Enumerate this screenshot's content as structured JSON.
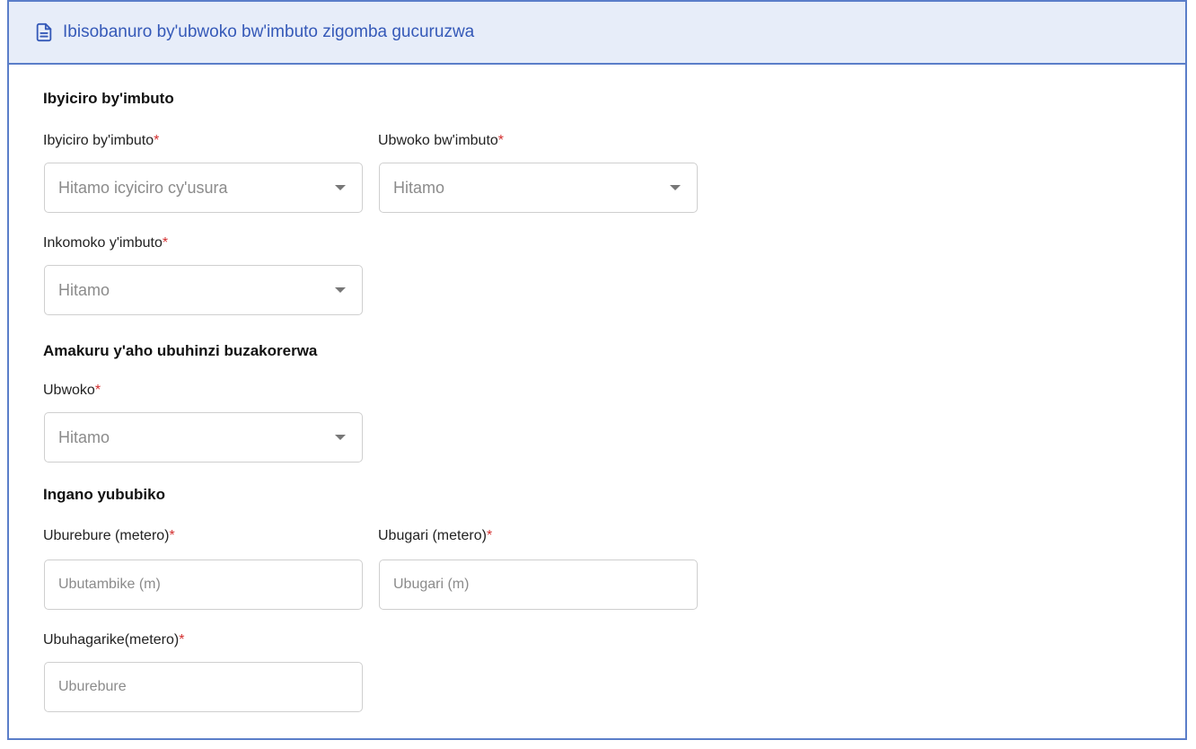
{
  "header": {
    "title": "Ibisobanuro by'ubwoko bw'imbuto zigomba gucuruzwa",
    "icon": "document-icon"
  },
  "sections": {
    "seed_stage": {
      "title": "Ibyiciro by'imbuto",
      "stage_label": "Ibyiciro by'imbuto",
      "stage_placeholder": "Hitamo icyiciro cy'usura",
      "type_label": "Ubwoko bw'imbuto",
      "type_placeholder": "Hitamo",
      "source_label": "Inkomoko y'imbuto",
      "source_placeholder": "Hitamo"
    },
    "farm_info": {
      "title": "Amakuru y'aho ubuhinzi buzakorerwa",
      "kind_label": "Ubwoko",
      "kind_placeholder": "Hitamo"
    },
    "storage_size": {
      "title": "Ingano yububiko",
      "length_label": "Uburebure (metero)",
      "length_placeholder": "Ubutambike (m)",
      "width_label": "Ubugari (metero)",
      "width_placeholder": "Ubugari (m)",
      "height_label": "Ubuhagarike(metero)",
      "height_placeholder": "Uburebure"
    }
  },
  "required_mark": "*",
  "colors": {
    "accent": "#3559b8",
    "border": "#5b7ec9",
    "header_bg": "#e7edf9",
    "required": "#d32f2f"
  }
}
